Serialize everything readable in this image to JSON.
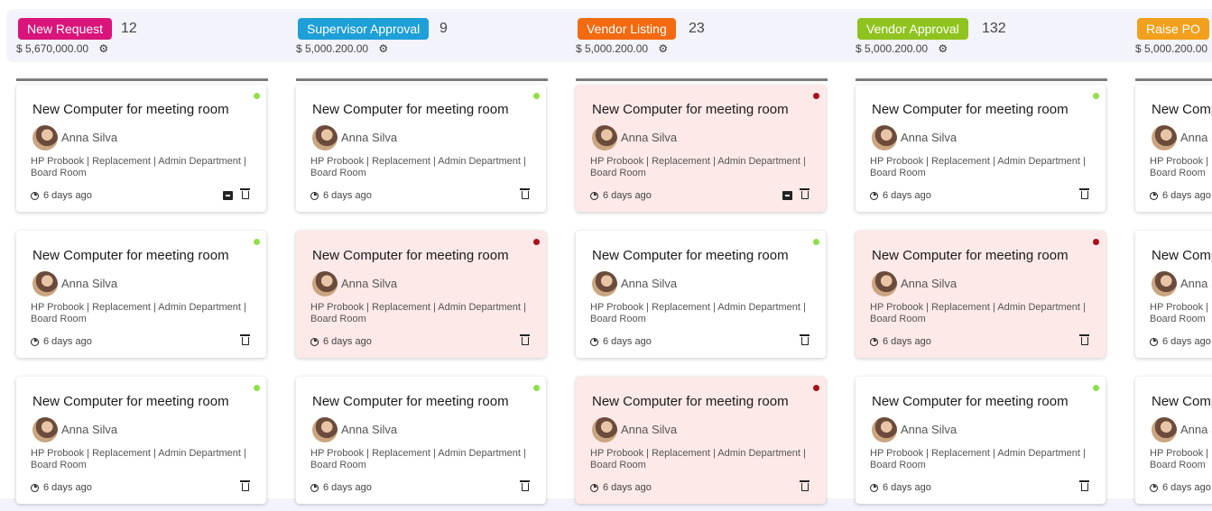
{
  "columns": [
    {
      "name": "New Request",
      "count": "12",
      "amount": "$ 5,670,000.00",
      "color": "#d9147a",
      "cards": [
        {
          "title": "New Computer for meeting room",
          "person": "Anna Silva",
          "details": "HP Probook | Replacement | Admin Department | Board Room",
          "time": "6 days ago",
          "status": "ok",
          "archive": true
        },
        {
          "title": "New Computer for meeting room",
          "person": "Anna Silva",
          "details": "HP Probook | Replacement | Admin Department | Board Room",
          "time": "6 days ago",
          "status": "ok",
          "archive": false
        },
        {
          "title": "New Computer for meeting room",
          "person": "Anna Silva",
          "details": "HP Probook | Replacement | Admin Department | Board Room",
          "time": "6 days ago",
          "status": "ok",
          "archive": false
        }
      ]
    },
    {
      "name": "Supervisor Approval",
      "count": "9",
      "amount": "$ 5,000.200.00",
      "color": "#1e9fd8",
      "cards": [
        {
          "title": "New Computer for meeting room",
          "person": "Anna Silva",
          "details": "HP Probook | Replacement | Admin Department | Board Room",
          "time": "6 days ago",
          "status": "ok",
          "archive": false
        },
        {
          "title": "New Computer for meeting room",
          "person": "Anna Silva",
          "details": "HP Probook | Replacement | Admin Department | Board Room",
          "time": "6 days ago",
          "status": "late",
          "archive": false
        },
        {
          "title": "New Computer for meeting room",
          "person": "Anna Silva",
          "details": "HP Probook | Replacement | Admin Department | Board Room",
          "time": "6 days ago",
          "status": "ok",
          "archive": false
        }
      ]
    },
    {
      "name": "Vendor Listing",
      "count": "23",
      "amount": "$ 5,000.200.00",
      "color": "#f36a10",
      "cards": [
        {
          "title": "New Computer for meeting room",
          "person": "Anna Silva",
          "details": "HP Probook | Replacement | Admin Department | Board Room",
          "time": "6 days ago",
          "status": "late",
          "archive": true
        },
        {
          "title": "New Computer for meeting room",
          "person": "Anna Silva",
          "details": "HP Probook | Replacement | Admin Department | Board Room",
          "time": "6 days ago",
          "status": "ok",
          "archive": false
        },
        {
          "title": "New Computer for meeting room",
          "person": "Anna Silva",
          "details": "HP Probook | Replacement | Admin Department | Board Room",
          "time": "6 days ago",
          "status": "late",
          "archive": false
        }
      ]
    },
    {
      "name": "Vendor Approval",
      "count": "132",
      "amount": "$ 5,000.200.00",
      "color": "#8fc31f",
      "cards": [
        {
          "title": "New Computer for meeting room",
          "person": "Anna Silva",
          "details": "HP Probook | Replacement | Admin Department | Board Room",
          "time": "6 days ago",
          "status": "ok",
          "archive": false
        },
        {
          "title": "New Computer for meeting room",
          "person": "Anna Silva",
          "details": "HP Probook | Replacement | Admin Department | Board Room",
          "time": "6 days ago",
          "status": "late",
          "archive": false
        },
        {
          "title": "New Computer for meeting room",
          "person": "Anna Silva",
          "details": "HP Probook | Replacement | Admin Department | Board Room",
          "time": "6 days ago",
          "status": "ok",
          "archive": false
        }
      ]
    },
    {
      "name": "Raise PO",
      "count": "",
      "amount": "$ 5,000.200.00",
      "color": "#f2a01d",
      "cards": [
        {
          "title": "New Computer for meeting room",
          "person": "Anna Silva",
          "details": "HP Probook | Replacement | Admin Department | Board Room",
          "time": "6 days ago",
          "status": "ok",
          "archive": false
        },
        {
          "title": "New Computer for meeting room",
          "person": "Anna Silva",
          "details": "HP Probook | Replacement | Admin Department | Board Room",
          "time": "6 days ago",
          "status": "ok",
          "archive": false
        },
        {
          "title": "New Computer for meeting room",
          "person": "Anna Silva",
          "details": "HP Probook | Replacement | Admin Department | Board Room",
          "time": "6 days ago",
          "status": "ok",
          "archive": false
        }
      ]
    }
  ],
  "status_colors": {
    "ok": "#8ee04a",
    "late": "#a8101a"
  },
  "icons": {
    "settings": "gear-icon",
    "time": "clock-icon",
    "delete": "trash-icon",
    "archive": "archive-icon"
  }
}
